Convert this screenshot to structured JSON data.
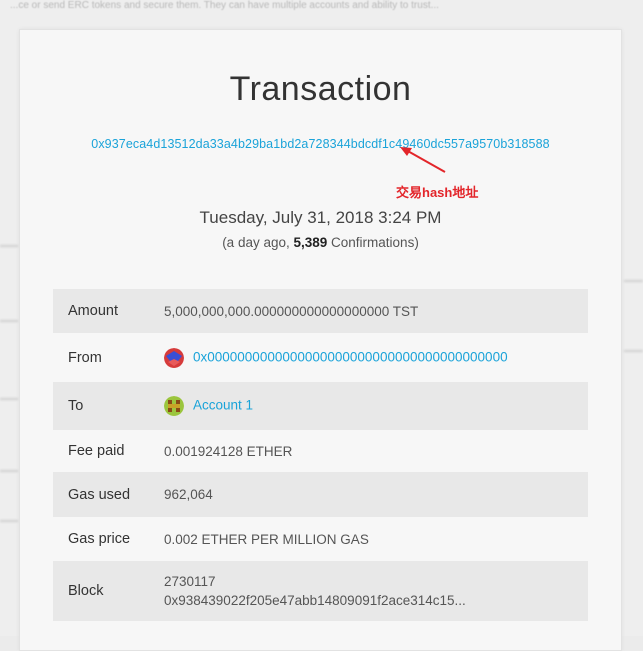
{
  "backdrop": {
    "top_text": "...ce or send ERC tokens and secure them. They can have multiple accounts and ability to trust..."
  },
  "page": {
    "title": "Transaction",
    "tx_hash": "0x937eca4d13512da33a4b29ba1bd2a728344bdcdf1c49460dc557a9570b318588",
    "annotation": "交易hash地址",
    "date": "Tuesday, July 31, 2018 3:24 PM",
    "conf_prefix": "(a day ago, ",
    "conf_count": "5,389",
    "conf_suffix": " Confirmations)"
  },
  "details": {
    "amount_label": "Amount",
    "amount_value": "5,000,000,000.000000000000000000 TST",
    "from_label": "From",
    "from_value": "0x0000000000000000000000000000000000000000",
    "to_label": "To",
    "to_value": "Account 1",
    "fee_label": "Fee paid",
    "fee_value": "0.001924128 ETHER",
    "gas_used_label": "Gas used",
    "gas_used_value": "962,064",
    "gas_price_label": "Gas price",
    "gas_price_value": "0.002 ETHER PER MILLION GAS",
    "block_label": "Block",
    "block_number": "2730117",
    "block_hash": "0x938439022f205e47abb14809091f2ace314c15..."
  },
  "colors": {
    "link": "#1aa3d9",
    "annotation": "#e3252a",
    "row_shade": "#e8e8e8"
  },
  "icons": {
    "from_avatar": "identicon-avatar",
    "to_avatar": "identicon-avatar",
    "annotation_arrow": "red-arrow"
  }
}
